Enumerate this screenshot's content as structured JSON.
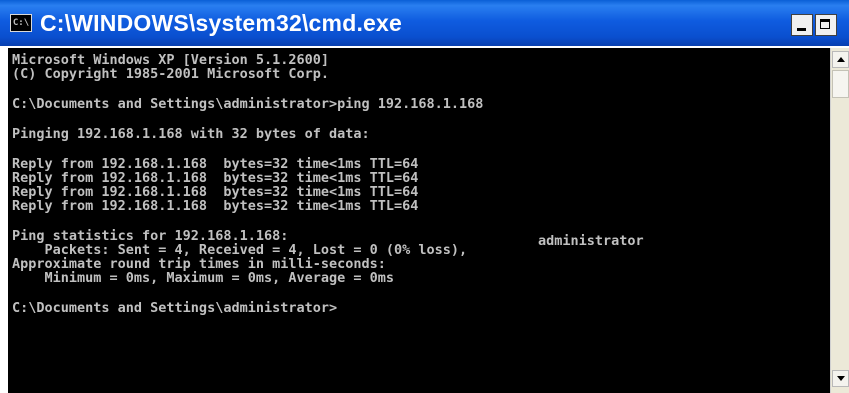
{
  "window": {
    "title": "C:\\WINDOWS\\system32\\cmd.exe",
    "icon_name": "cmd-icon",
    "icon_glyph": "C:\\"
  },
  "console": {
    "lines": [
      "Microsoft Windows XP [Version 5.1.2600]",
      "(C) Copyright 1985-2001 Microsoft Corp.",
      "",
      "C:\\Documents and Settings\\administrator>ping 192.168.1.168",
      "",
      "Pinging 192.168.1.168 with 32 bytes of data:",
      "",
      "Reply from 192.168.1.168  bytes=32 time<1ms TTL=64",
      "Reply from 192.168.1.168  bytes=32 time<1ms TTL=64",
      "Reply from 192.168.1.168  bytes=32 time<1ms TTL=64",
      "Reply from 192.168.1.168  bytes=32 time<1ms TTL=64",
      "",
      "Ping statistics for 192.168.1.168:",
      "    Packets: Sent = 4, Received = 4, Lost = 0 (0% loss),",
      "Approximate round trip times in milli-seconds:",
      "    Minimum = 0ms, Maximum = 0ms, Average = 0ms",
      "",
      "C:\\Documents and Settings\\administrator>"
    ],
    "overlay_label": "administrator"
  },
  "colors": {
    "titlebar": "#0a4fcf",
    "console_bg": "#000000",
    "console_fg": "#c0c0c0"
  },
  "icons": {
    "minimize": "minimize-icon",
    "maximize": "maximize-icon",
    "scroll_up": "scroll-up-arrow-icon",
    "scroll_down": "scroll-down-arrow-icon"
  }
}
